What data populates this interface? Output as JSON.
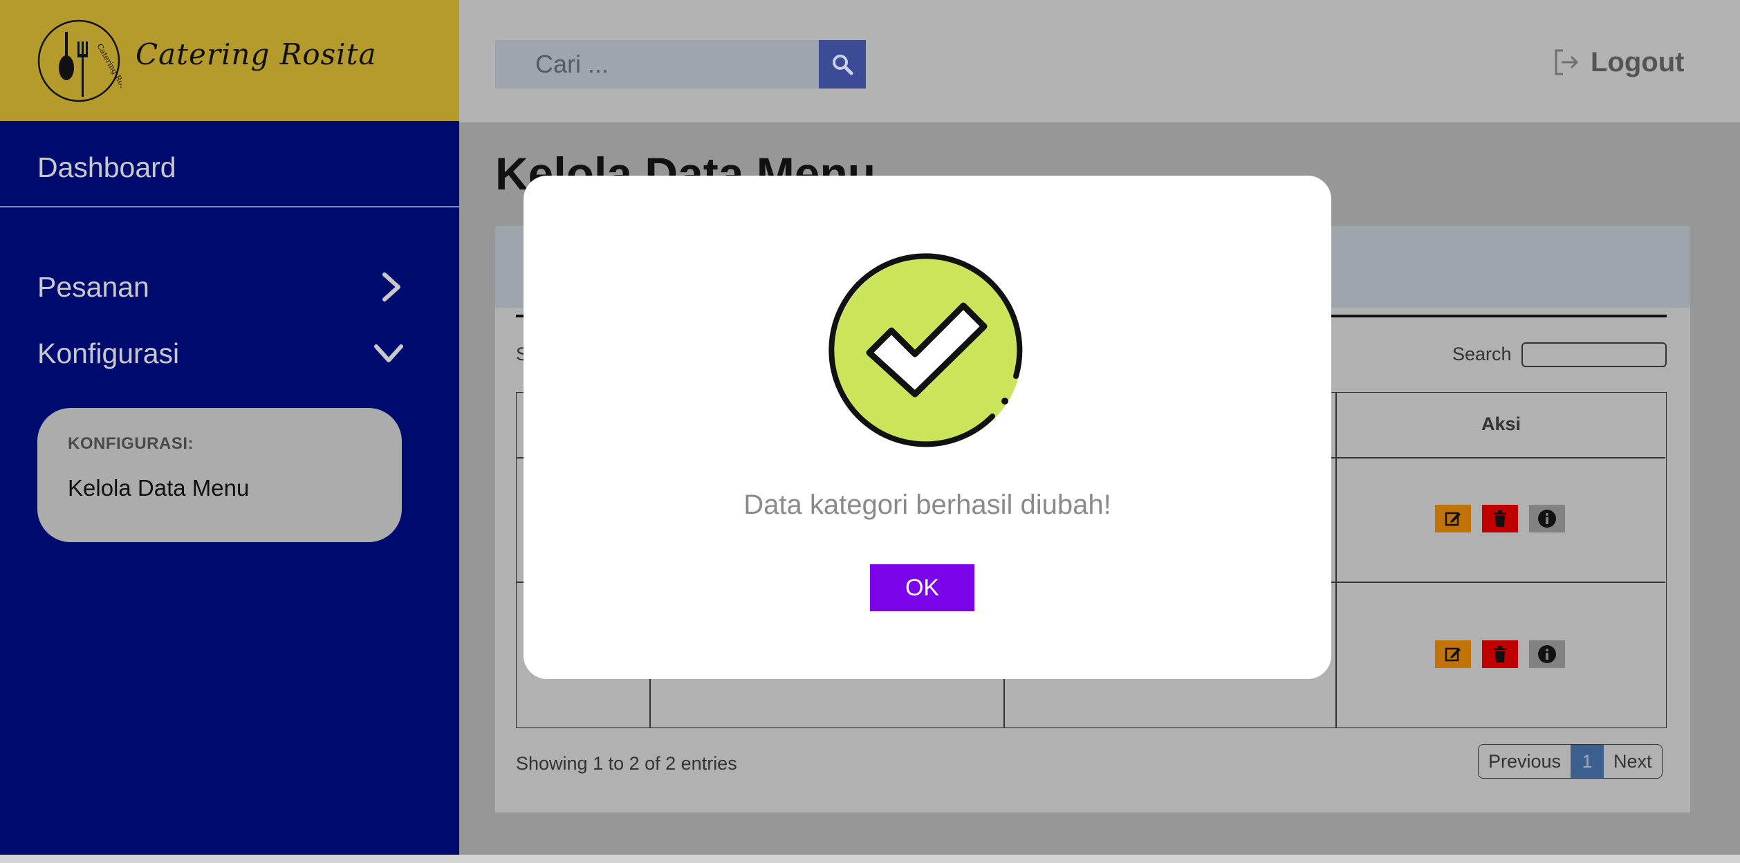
{
  "brand": {
    "name": "Catering Rosita",
    "logo_ring_text": "Catering Rosita",
    "color": "#b49b2c"
  },
  "header": {
    "search": {
      "placeholder": "Cari ...",
      "icon": "search-icon"
    },
    "logout": {
      "label": "Logout",
      "icon": "logout-icon"
    }
  },
  "sidebar": {
    "dashboard": "Dashboard",
    "items": [
      {
        "label": "Pesanan",
        "icon": "chevron-right-icon"
      },
      {
        "label": "Konfigurasi",
        "icon": "chevron-down-icon"
      }
    ],
    "submenu": {
      "heading": "KONFIGURASI:",
      "link": "Kelola Data Menu"
    }
  },
  "main": {
    "title": "Kelola Data Menu",
    "show_label": "S",
    "search_label": "Search",
    "table": {
      "headers": {
        "aksi": "Aksi"
      },
      "actions": [
        "edit-icon",
        "trash-icon",
        "info-icon"
      ],
      "row_count": 2
    },
    "showing_text": "Showing 1 to  2 of 2 entries",
    "pagination": {
      "previous": "Previous",
      "current": "1",
      "next": "Next"
    }
  },
  "modal": {
    "icon": "check-circle-icon",
    "icon_color": "#cbe55a",
    "message": "Data kategori berhasil diubah!",
    "ok_label": "OK",
    "ok_color": "#7b04ea"
  }
}
